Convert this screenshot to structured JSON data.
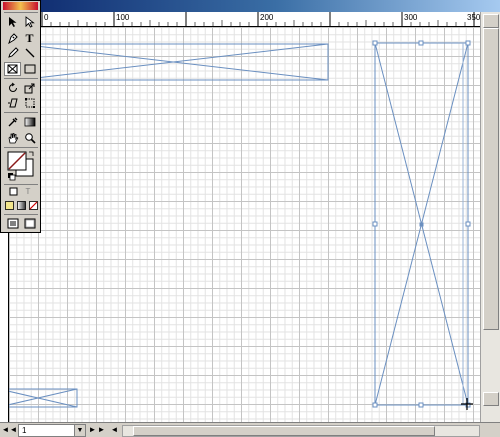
{
  "ruler": {
    "labels": [
      "0",
      "100",
      "200",
      "300",
      "350"
    ]
  },
  "status": {
    "page_value": "1",
    "prev_first_glyph": "◄",
    "prev_glyph": "◄",
    "next_glyph": "►",
    "next_last_glyph": "►"
  },
  "toolbox": {
    "type_tool_glyph": "T",
    "tools": [
      "selection-tool",
      "direct-selection-tool",
      "pen-tool",
      "type-tool",
      "pencil-tool",
      "line-tool",
      "rectangle-frame-tool",
      "rectangle-tool",
      "rotate-tool",
      "scale-tool",
      "shear-tool",
      "free-transform-tool",
      "eyedropper-tool",
      "gradient-tool",
      "hand-tool",
      "zoom-tool"
    ]
  },
  "colors": {
    "frame_stroke": "#6a8fc0",
    "grid_major": "#c4c4c4",
    "grid_minor": "#e2e2e2",
    "stroke_swatch": "#8b1a1a"
  }
}
